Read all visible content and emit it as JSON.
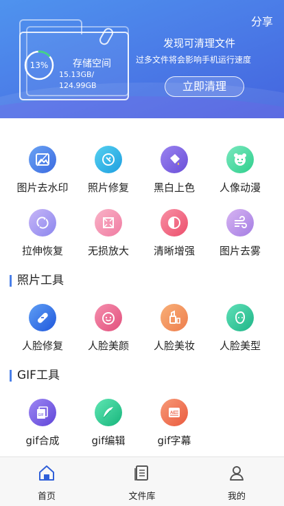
{
  "header": {
    "share_label": "分享",
    "storage_percent_label": "13%",
    "storage_percent": 13,
    "storage_title": "存储空间",
    "storage_used": "15.13GB/",
    "storage_total": "124.99GB",
    "discover_title": "发现可清理文件",
    "discover_subtitle": "过多文件将会影响手机运行速度",
    "clean_button_label": "立即清理",
    "colors": {
      "banner_start": "#4f93ee",
      "banner_end": "#4464de",
      "ring_progress": "#43d18a"
    }
  },
  "tools_row1": [
    {
      "label": "图片去水印",
      "icon": "image-watermark-icon",
      "color": "#4a7fe8"
    },
    {
      "label": "照片修复",
      "icon": "photo-repair-icon",
      "color": "#29b6e6"
    },
    {
      "label": "黑白上色",
      "icon": "paint-bucket-icon",
      "color": "#7b62e0"
    },
    {
      "label": "人像动漫",
      "icon": "bear-face-icon",
      "color": "#43d79d"
    }
  ],
  "tools_row2": [
    {
      "label": "拉伸恢复",
      "icon": "stretch-restore-icon",
      "color": "#9a8cf2"
    },
    {
      "label": "无损放大",
      "icon": "enlarge-icon",
      "color": "#f27ea6"
    },
    {
      "label": "清晰增强",
      "icon": "clarity-icon",
      "color": "#f0617a"
    },
    {
      "label": "图片去雾",
      "icon": "wind-icon",
      "color": "#b27ee6"
    }
  ],
  "section_photo": "照片工具",
  "tools_photo": [
    {
      "label": "人脸修复",
      "icon": "bandage-icon",
      "color": "#2f6fe6"
    },
    {
      "label": "人脸美颜",
      "icon": "smile-face-icon",
      "color": "#ea5f87"
    },
    {
      "label": "人脸美妆",
      "icon": "makeup-icon",
      "color": "#f0925e"
    },
    {
      "label": "人脸美型",
      "icon": "face-outline-icon",
      "color": "#2fc79a"
    }
  ],
  "section_gif": "GIF工具",
  "tools_gif": [
    {
      "label": "gif合成",
      "icon": "gif-compose-icon",
      "color": "#7a60e2"
    },
    {
      "label": "gif编辑",
      "icon": "feather-icon",
      "color": "#2ec98f"
    },
    {
      "label": "gif字幕",
      "icon": "subtitle-icon",
      "color": "#ef6c4f"
    }
  ],
  "tabbar": {
    "home": "首页",
    "files": "文件库",
    "mine": "我的"
  }
}
